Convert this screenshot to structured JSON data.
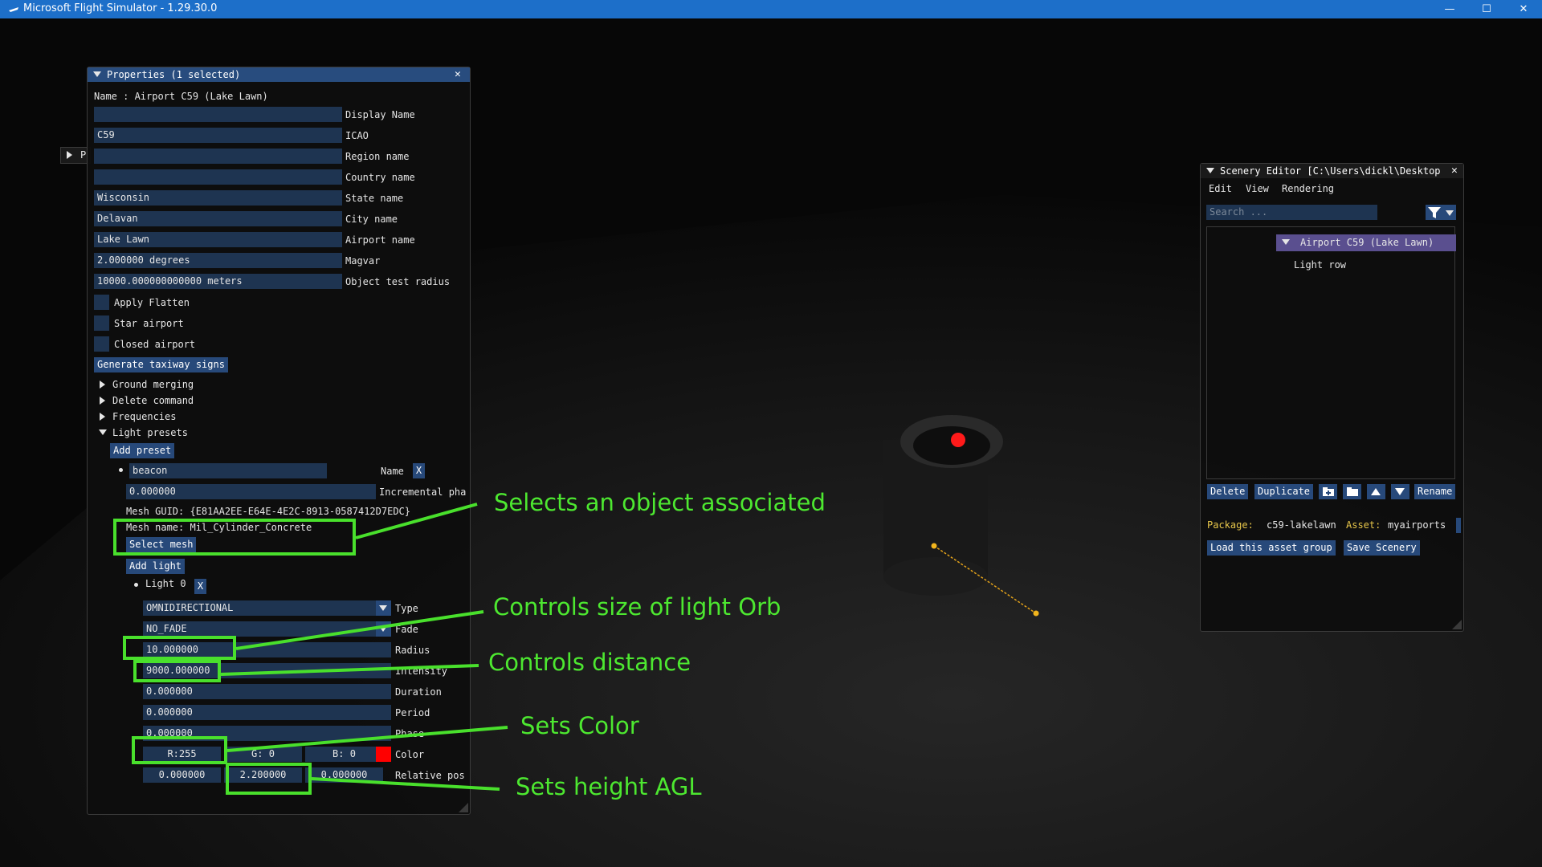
{
  "window": {
    "title": "Microsoft Flight Simulator - 1.29.30.0",
    "controls": {
      "minimize": "—",
      "maximize": "☐",
      "close": "✕"
    }
  },
  "collapsed_panel": {
    "label": "P"
  },
  "properties": {
    "title": "Properties (1 selected)",
    "name_line": "Name : Airport C59 (Lake Lawn)",
    "fields": [
      {
        "value": "",
        "label": "Display Name"
      },
      {
        "value": "C59",
        "label": "ICAO"
      },
      {
        "value": "",
        "label": "Region name"
      },
      {
        "value": "",
        "label": "Country name"
      },
      {
        "value": "Wisconsin",
        "label": "State name"
      },
      {
        "value": "Delavan",
        "label": "City name"
      },
      {
        "value": "Lake Lawn",
        "label": "Airport name"
      },
      {
        "value": "2.000000 degrees",
        "label": "Magvar"
      },
      {
        "value": "10000.000000000000 meters",
        "label": "Object test radius"
      }
    ],
    "checkboxes": [
      "Apply Flatten",
      "Star airport",
      "Closed airport"
    ],
    "generate_button": "Generate taxiway signs",
    "tree": [
      "Ground merging",
      "Delete command",
      "Frequencies",
      "Light presets"
    ],
    "add_preset": "Add preset",
    "preset": {
      "name_value": "beacon",
      "name_label": "Name",
      "x": "X",
      "incremental_value": "0.000000",
      "incremental_label": "Incremental pha",
      "mesh_guid": "Mesh GUID: {E81AA2EE-E64E-4E2C-8913-0587412D7EDC}",
      "mesh_name": "Mesh name: Mil_Cylinder_Concrete",
      "select_mesh": "Select mesh",
      "add_light": "Add light"
    },
    "light": {
      "label": "Light 0",
      "x": "X",
      "type_value": "OMNIDIRECTIONAL",
      "type_label": "Type",
      "fade_value": "NO_FADE",
      "fade_label": "Fade",
      "radius_value": "10.000000",
      "radius_label": "Radius",
      "intensity_value": "9000.000000",
      "intensity_label": "Intensity",
      "duration_value": "0.000000",
      "duration_label": "Duration",
      "period_value": "0.000000",
      "period_label": "Period",
      "phase_value": "0.000000",
      "phase_label": "Phase",
      "color_r": "R:255",
      "color_g": "G:  0",
      "color_b": "B:  0",
      "color_swatch": "#ff0000",
      "color_label": "Color",
      "pos_x": "0.000000",
      "pos_y": "2.200000",
      "pos_z": "0.000000",
      "pos_label": "Relative pos"
    }
  },
  "scenery_editor": {
    "title": "Scenery Editor [C:\\Users\\dickl\\Desktop",
    "menu": [
      "Edit",
      "View",
      "Rendering"
    ],
    "search_placeholder": "Search ...",
    "tree_root": "Airport C59 (Lake Lawn)",
    "tree_child": "Light row",
    "buttons": {
      "delete": "Delete",
      "duplicate": "Duplicate",
      "rename": "Rename"
    },
    "package_label": "Package:",
    "package_value": "c59-lakelawn",
    "asset_label": "Asset:",
    "asset_value": "myairports",
    "load_button": "Load this asset group",
    "save_button": "Save Scenery"
  },
  "annotations": [
    "Selects an object associated",
    "Controls size of light Orb",
    "Controls distance",
    "Sets Color",
    "Sets height AGL"
  ],
  "colors": {
    "annotation": "#49e02c",
    "title_bar": "#1d6fc9",
    "light_orb": "#ff1a1a",
    "gizmo_line": "#e3a21a"
  }
}
